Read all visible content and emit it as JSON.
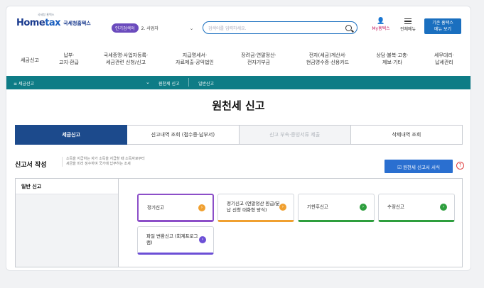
{
  "header": {
    "logo_tag": "국세청 홈택스",
    "logo_home": "Home",
    "logo_tax": "tax",
    "logo_sub": "국세청홈택스",
    "hot_badge": "인기검색어",
    "hot_text": "2. 사업자",
    "search_placeholder": "검색어를 입력하세요.",
    "myhome_label": "My홈택스",
    "menu_label": "전체메뉴",
    "old_menu_line1": "기존 홈택스",
    "old_menu_line2": "메뉴 보기"
  },
  "nav": [
    {
      "l1": "세금신고",
      "l2": ""
    },
    {
      "l1": "납부·",
      "l2": "고지·환급"
    },
    {
      "l1": "국세증명·사업자등록·",
      "l2": "세금관련 신청/신고"
    },
    {
      "l1": "지급명세서·",
      "l2": "자료제출·공익법인"
    },
    {
      "l1": "장려금·연말정산·",
      "l2": "전자기부금"
    },
    {
      "l1": "전자(세금)계산서·",
      "l2": "현금영수증·신용카드"
    },
    {
      "l1": "상담·불복·고충·",
      "l2": "제보·기타"
    },
    {
      "l1": "세무대리·",
      "l2": "납세관리"
    }
  ],
  "breadcrumb": {
    "root": "≡  세금신고",
    "level1": "원천세 신고",
    "level2": "일반신고"
  },
  "page_title": "원천세 신고",
  "tabs": [
    {
      "label": "세금신고",
      "state": "active"
    },
    {
      "label": "신고내역 조회 (접수증·납부서)",
      "state": "normal"
    },
    {
      "label": "신고 부속·증빙서류 제출",
      "state": "disabled"
    },
    {
      "label": "삭제내역 조회",
      "state": "normal"
    }
  ],
  "section": {
    "title": "신고서 작성",
    "desc_line1": "소득을 지급하는 자가 소득을 지급할 때 소득자로부터",
    "desc_line2": "세금을 미리 징수하여 국가에 납부하는 조세",
    "sample_button": "☑ 원천세 신고서 서식",
    "help": "?"
  },
  "panel": {
    "side_title": "일반 신고",
    "cards": [
      {
        "label": "정기신고",
        "color": "#f0a030"
      },
      {
        "label": "정기신고 (연말정산 환급/분납 신청 대화형 방식)",
        "color": "#f0a030"
      },
      {
        "label": "기한후신고",
        "color": "#2e9e3e"
      },
      {
        "label": "수정신고",
        "color": "#2e9e3e"
      },
      {
        "label": "파일 변환신고 (회계프로그램)",
        "color": "#6c4fd6"
      }
    ]
  },
  "colors": {
    "teal": "#0e7c86",
    "active_tab": "#1c4a8c",
    "accent_blue": "#2a6fd0",
    "selected_card": "#8c4fc8"
  }
}
